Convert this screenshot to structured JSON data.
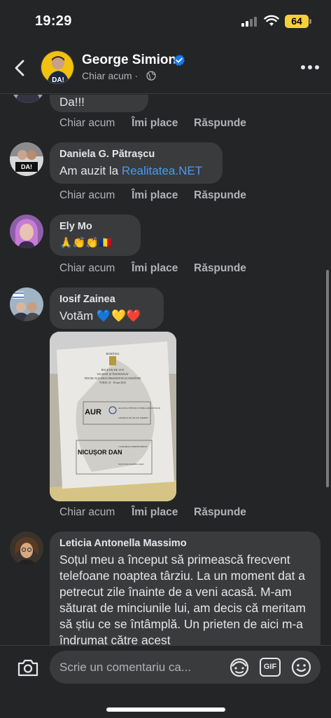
{
  "status_bar": {
    "time": "19:29",
    "battery": "64"
  },
  "header": {
    "title": "George Simion",
    "subtitle": "Chiar acum ·",
    "avatar_text": "DA!"
  },
  "comments": [
    {
      "name": "",
      "text": "Da!!!",
      "time": "Chiar acum",
      "like": "Îmi place",
      "reply": "Răspunde"
    },
    {
      "name": "Daniela G. Pătrașcu",
      "text": "Am auzit la ",
      "link": "Realitatea.NET",
      "time": "Chiar acum",
      "like": "Îmi place",
      "reply": "Răspunde",
      "avatar_text": "DA!"
    },
    {
      "name": "Ely Mo",
      "text": "🙏👏👏🇷🇴",
      "time": "Chiar acum",
      "like": "Îmi place",
      "reply": "Răspunde"
    },
    {
      "name": "Iosif Zainea",
      "text": "Votăm 💙💛❤️",
      "time": "Chiar acum",
      "like": "Îmi place",
      "reply": "Răspunde",
      "photo": {
        "heading": "ROMÂNIA",
        "title_lines": [
          "BULETIN DE VOT",
          "VALIDAT ȘI ÎNSTRĂINAT",
          "PENTRU ALEGEREA PREȘEDINTELUI ROMÂNIEI",
          "TURUL II - 18 mai 2025"
        ],
        "party_logo": "AUR",
        "candidate_1": "GEORGE-NICOLAE SIMION",
        "party_1": "ALIANȚA PENTRU UNIREA ROMÂNILOR",
        "logo_2": "NICUȘOR DAN",
        "party_2": "CANDIDAT INDEPENDENT",
        "candidate_2": "NICUȘOR DANIEL DAN"
      }
    },
    {
      "name": "Leticia Antonella Massimo",
      "text": "Soțul meu a început să primească frecvent telefoane noaptea târziu. La un moment dat a petrecut zile înainte de a veni acasă. M-am săturat de minciunile lui, am decis că meritam să știu ce se întâmplă.  Un prieten de aici m-a îndrumat către acest"
    }
  ],
  "composer": {
    "placeholder": "Scrie un comentariu ca...",
    "gif_label": "GIF"
  },
  "colors": {
    "link": "#4599ff",
    "bubble": "#3a3b3c",
    "background": "#242526",
    "verified": "#1877f2"
  }
}
